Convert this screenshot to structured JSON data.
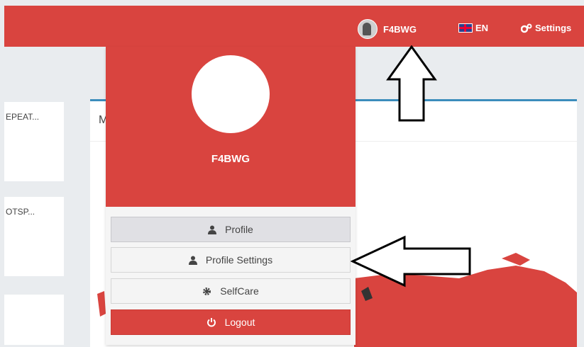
{
  "navbar": {
    "username": "F4BWG",
    "language": "EN",
    "settings_label": "Settings",
    "background": "#d9443f"
  },
  "cards": {
    "card_a_title": "EPEAT...",
    "card_b_title": "OTSP...",
    "main_title": "M"
  },
  "user_menu": {
    "name": "F4BWG",
    "items": [
      {
        "label": "Profile",
        "icon": "user-icon"
      },
      {
        "label": "Profile Settings",
        "icon": "user-icon"
      },
      {
        "label": "SelfCare",
        "icon": "gear-icon"
      },
      {
        "label": "Logout",
        "icon": "power-icon"
      }
    ]
  },
  "colors": {
    "accent_red": "#d9443f",
    "panel_border_blue": "#3c8dbc"
  }
}
